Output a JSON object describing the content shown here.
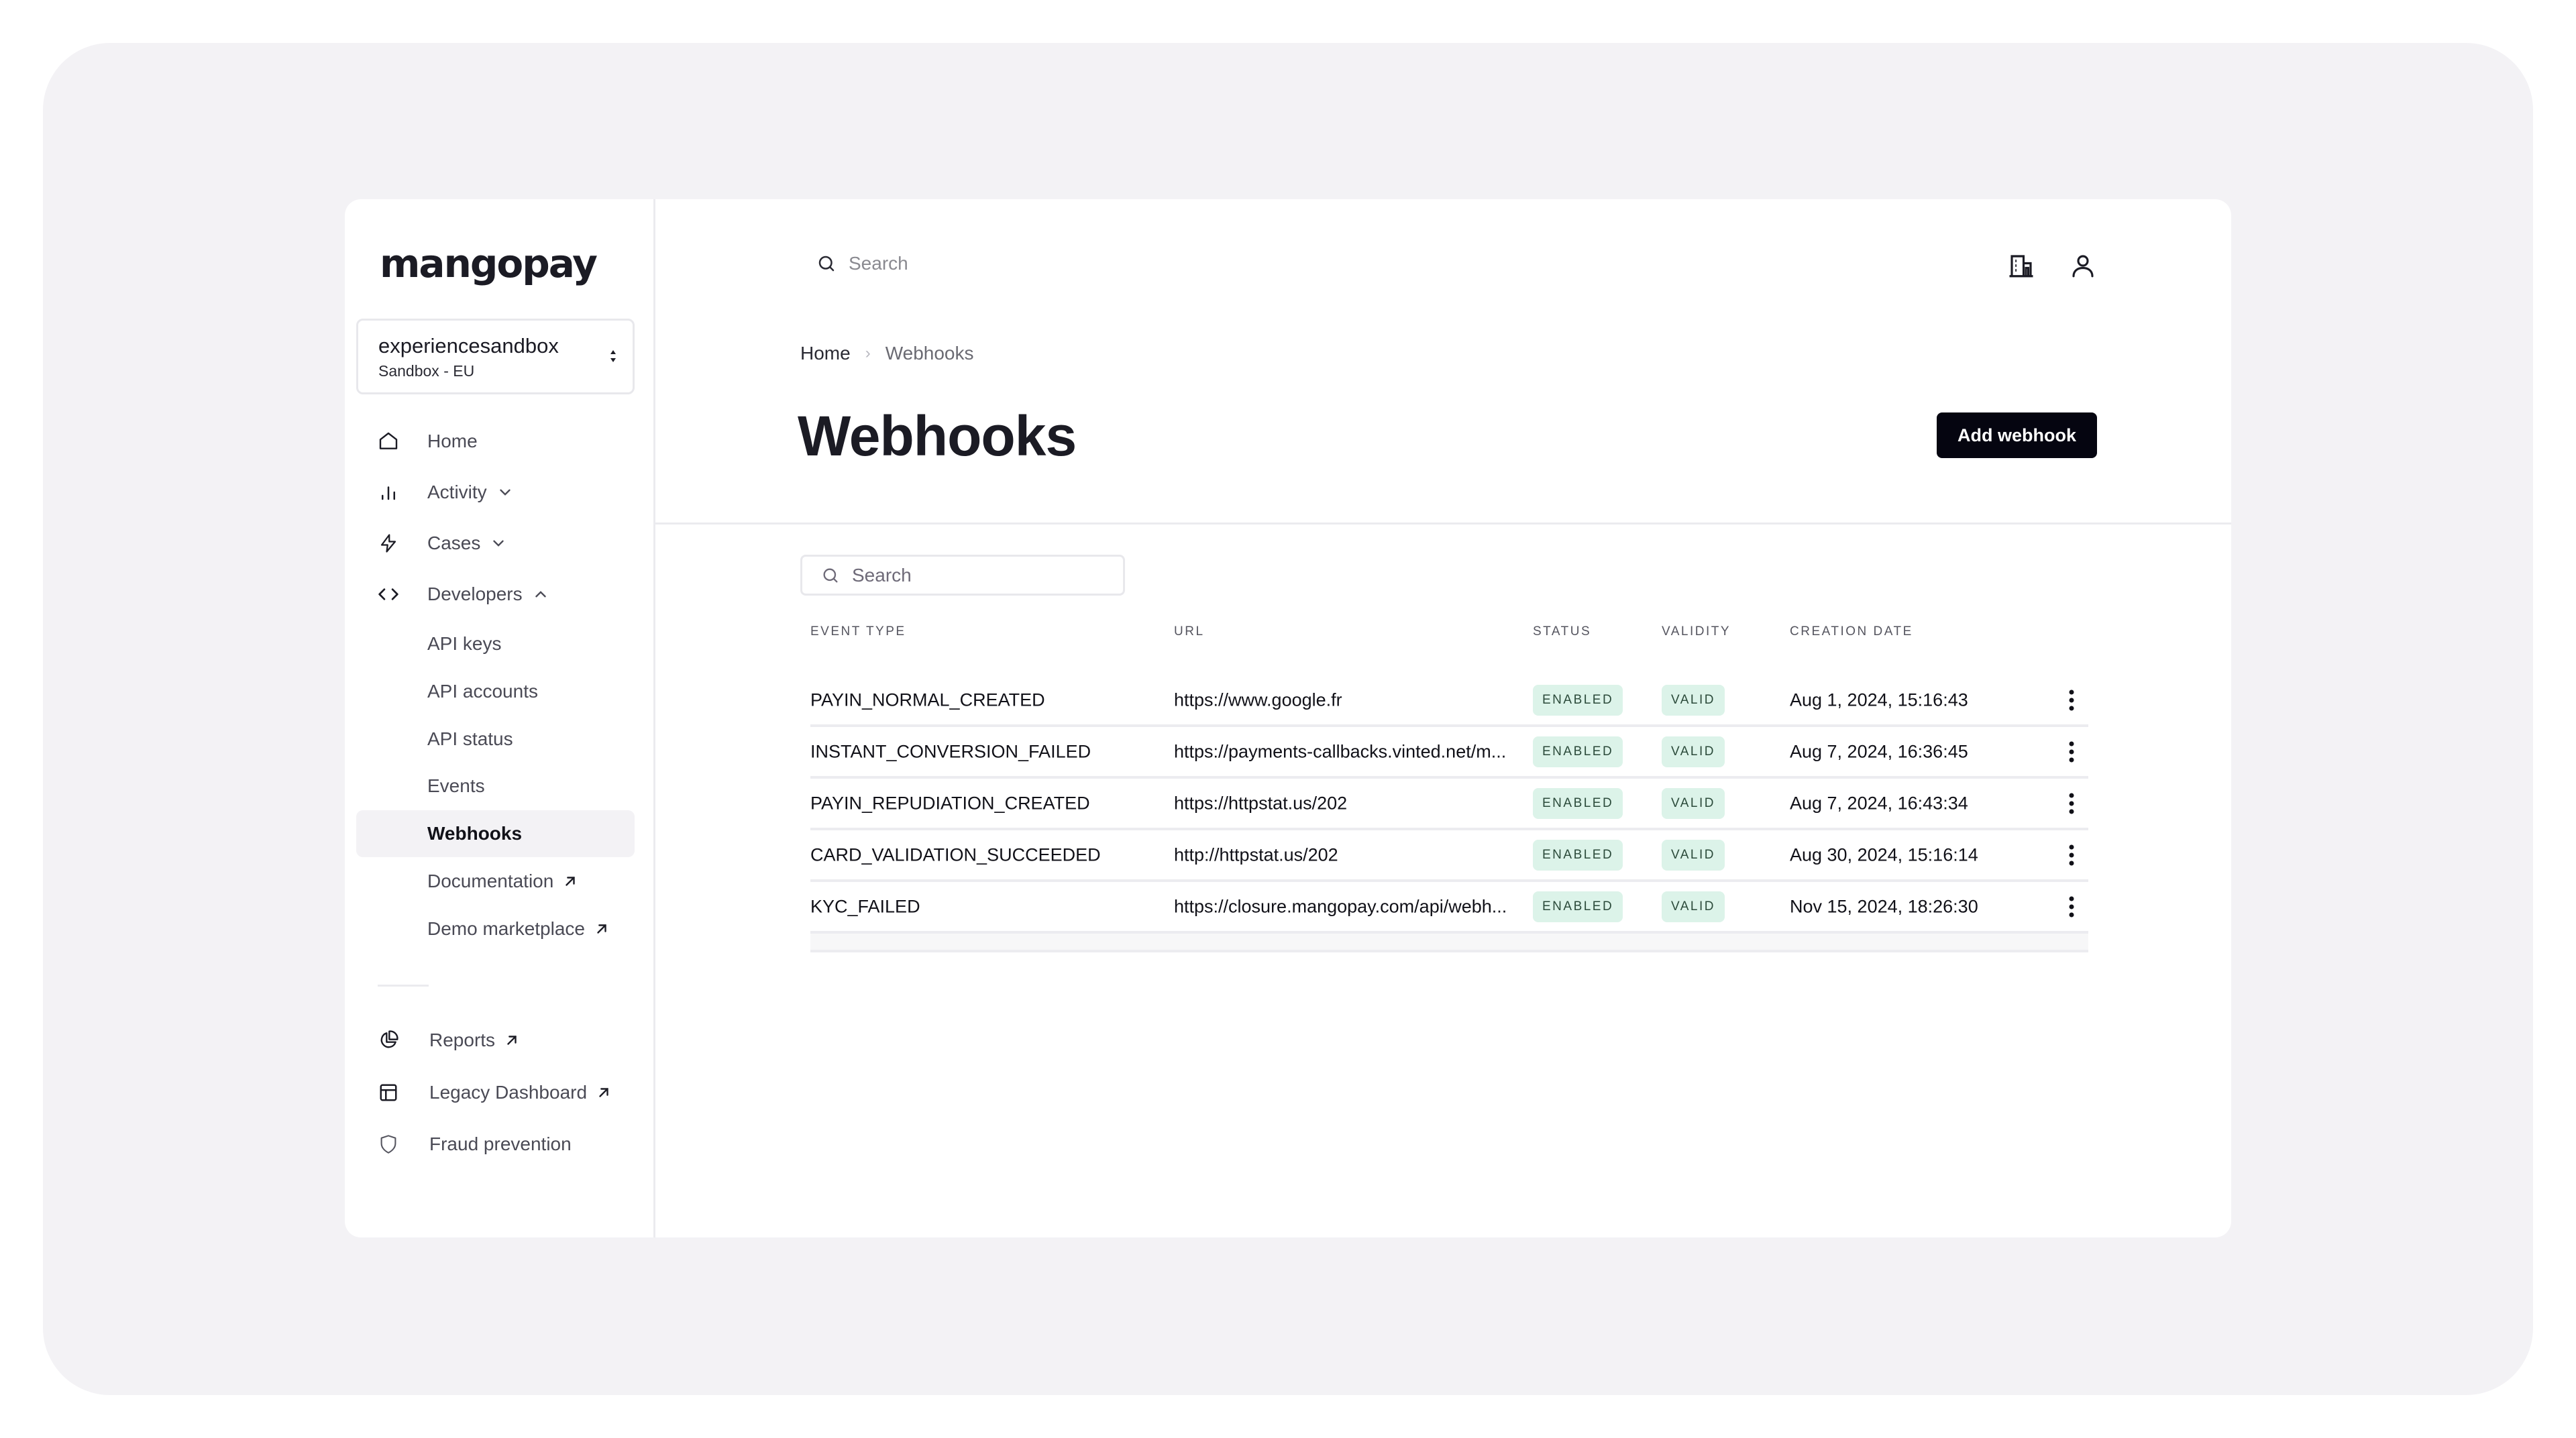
{
  "brand": {
    "logo_text": "mangopay"
  },
  "workspace": {
    "name": "experiencesandbox",
    "environment": "Sandbox - EU"
  },
  "sidebar": {
    "items": [
      {
        "label": "Home",
        "icon": "home-icon"
      },
      {
        "label": "Activity",
        "icon": "bar-chart-icon",
        "expandable": true,
        "expanded": false
      },
      {
        "label": "Cases",
        "icon": "lightning-icon",
        "expandable": true,
        "expanded": false
      },
      {
        "label": "Developers",
        "icon": "code-icon",
        "expandable": true,
        "expanded": true
      }
    ],
    "developer_items": [
      {
        "label": "API keys"
      },
      {
        "label": "API accounts"
      },
      {
        "label": "API status"
      },
      {
        "label": "Events"
      },
      {
        "label": "Webhooks",
        "active": true
      },
      {
        "label": "Documentation",
        "external": true
      },
      {
        "label": "Demo marketplace",
        "external": true
      }
    ],
    "bottom_items": [
      {
        "label": "Reports",
        "icon": "pie-chart-icon",
        "external": true
      },
      {
        "label": "Legacy Dashboard",
        "icon": "layout-icon",
        "external": true
      },
      {
        "label": "Fraud prevention",
        "icon": "shield-icon"
      }
    ]
  },
  "header": {
    "search_placeholder": "Search",
    "icons": [
      "building-icon",
      "user-icon"
    ]
  },
  "breadcrumb": {
    "home": "Home",
    "separator": "›",
    "current": "Webhooks"
  },
  "page": {
    "title": "Webhooks",
    "add_button": "Add webhook"
  },
  "table": {
    "search_placeholder": "Search",
    "columns": [
      "EVENT TYPE",
      "URL",
      "STATUS",
      "VALIDITY",
      "CREATION DATE"
    ],
    "rows": [
      {
        "event_type": "PAYIN_NORMAL_CREATED",
        "url": "https://www.google.fr",
        "status": "ENABLED",
        "validity": "VALID",
        "created": "Aug 1, 2024, 15:16:43"
      },
      {
        "event_type": "INSTANT_CONVERSION_FAILED",
        "url": "https://payments-callbacks.vinted.net/m...",
        "status": "ENABLED",
        "validity": "VALID",
        "created": "Aug 7, 2024, 16:36:45"
      },
      {
        "event_type": "PAYIN_REPUDIATION_CREATED",
        "url": "https://httpstat.us/202",
        "status": "ENABLED",
        "validity": "VALID",
        "created": "Aug 7, 2024, 16:43:34"
      },
      {
        "event_type": "CARD_VALIDATION_SUCCEEDED",
        "url": "http://httpstat.us/202",
        "status": "ENABLED",
        "validity": "VALID",
        "created": "Aug 30, 2024, 15:16:14"
      },
      {
        "event_type": "KYC_FAILED",
        "url": "https://closure.mangopay.com/api/webh...",
        "status": "ENABLED",
        "validity": "VALID",
        "created": "Nov 15, 2024, 18:26:30"
      }
    ]
  },
  "colors": {
    "backdrop": "#f3f2f5",
    "primary_button": "#050510",
    "badge_bg": "#dcf3e9",
    "badge_text": "#2b4a3a",
    "text": "#1b1b24"
  }
}
